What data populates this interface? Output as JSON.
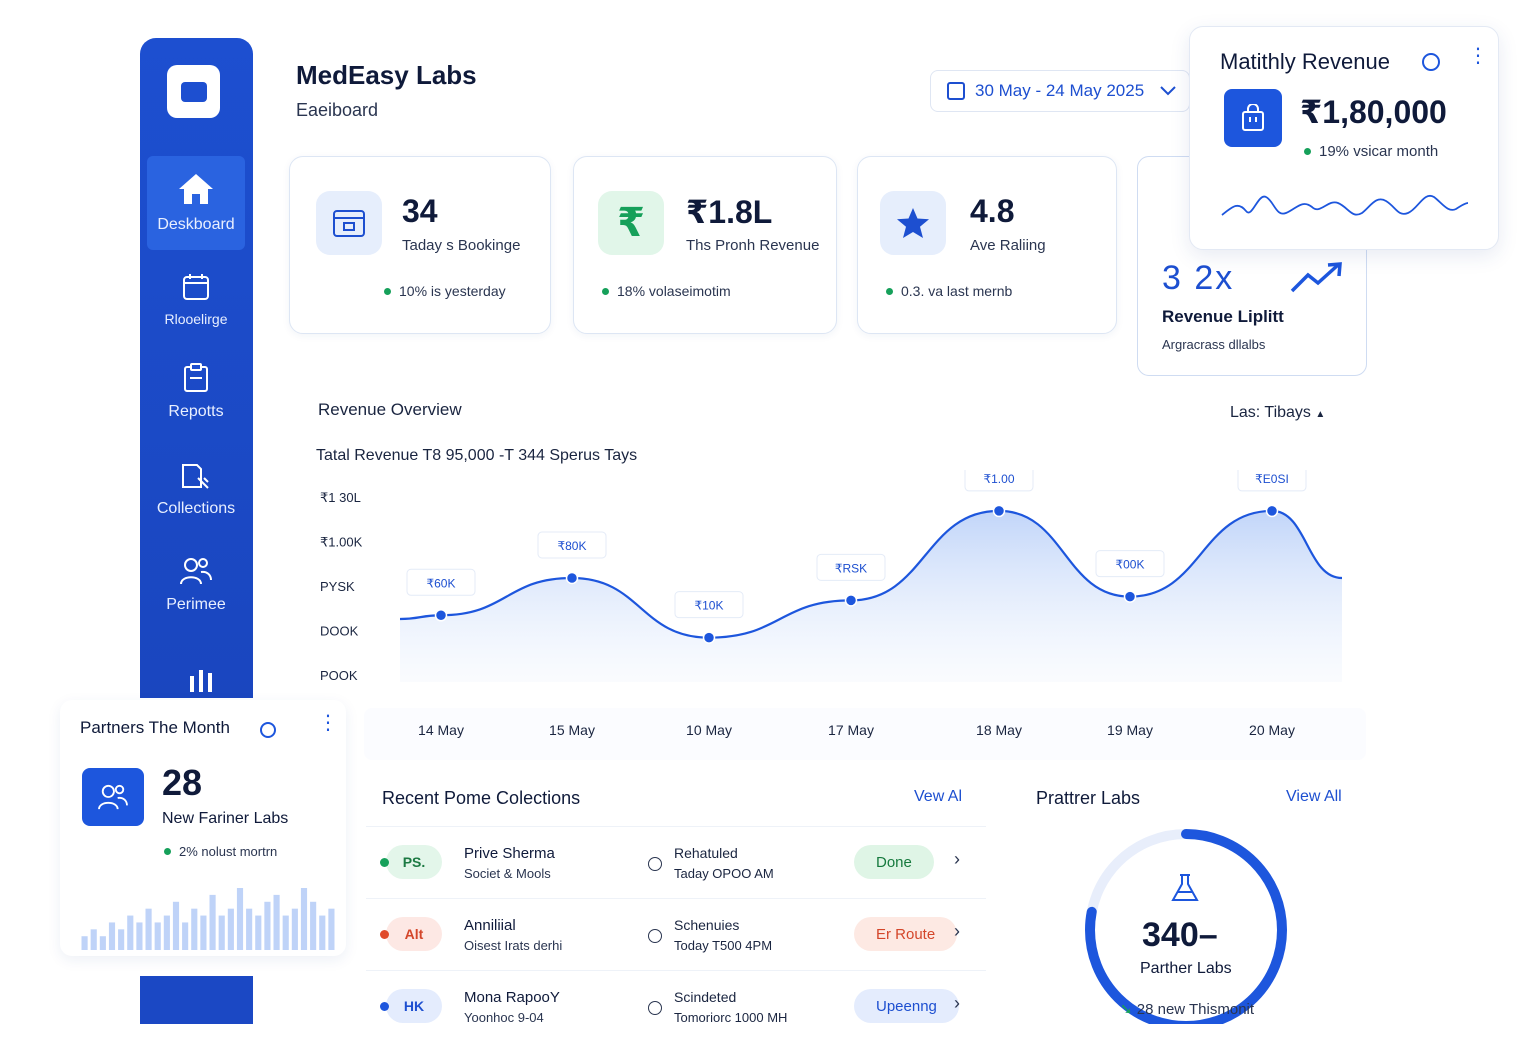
{
  "header": {
    "title": "MedEasy Labs",
    "subtitle": "Eaeiboard"
  },
  "date_range": "30 May - 24 May 2025",
  "sidebar": {
    "items": [
      {
        "label": "Deskboard",
        "icon": "home-icon",
        "active": true
      },
      {
        "label": "Rlooelirge",
        "icon": "calendar-icon"
      },
      {
        "label": "Repotts",
        "icon": "report-icon"
      },
      {
        "label": "Collections",
        "icon": "collections-icon"
      },
      {
        "label": "Perimee",
        "icon": "users-icon"
      }
    ]
  },
  "stats": [
    {
      "value": "34",
      "label": "Taday s Bookinge",
      "note": "10% is yesterday",
      "note_color": "#16a05a"
    },
    {
      "value": "₹1.8L",
      "label": "Ths Pronh Revenue",
      "note": "18% volaseimotim",
      "note_color": "#16a05a"
    },
    {
      "value": "4.8",
      "label": "Ave Raliing",
      "note": "0.3. va last mernb",
      "note_color": "#16a05a"
    }
  ],
  "lift": {
    "value": "3 2x",
    "label": "Revenue Liplitt",
    "sub": "Argracrass dllalbs"
  },
  "monthly": {
    "title": "Matithly Revenue",
    "value": "₹1,80,000",
    "note": "19% vsicar month"
  },
  "chart_data": {
    "type": "area",
    "title": "Revenue Overview",
    "range_label": "Las: Tibays",
    "subtitle": "Tatal Revenue  T8 95,000 -T 344  Sperus Tays",
    "y_tick_labels": [
      "₹1 30L",
      "₹1.00K",
      "PYSK",
      "DOOK",
      "POOK"
    ],
    "x_labels": [
      "14 May",
      "15 May",
      "10 May",
      "17 May",
      "18 May",
      "19 May",
      "20 May"
    ],
    "points": [
      {
        "x": "14 May",
        "value": 5.2,
        "label": "₹60K"
      },
      {
        "x": "15 May",
        "value": 6.2,
        "label": "₹80K"
      },
      {
        "x": "10 May",
        "value": 4.6,
        "label": "₹10K"
      },
      {
        "x": "17 May",
        "value": 5.6,
        "label": "₹RSK"
      },
      {
        "x": "18 May",
        "value": 8.0,
        "label": "₹1.00"
      },
      {
        "x": "19 May",
        "value": 5.7,
        "label": "₹00K"
      },
      {
        "x": "20 May",
        "value": 8.0,
        "label": "₹E0SI"
      }
    ],
    "accent": "#1d56dd"
  },
  "partners": {
    "title": "Partners The Month",
    "value": "28",
    "label": "New Fariner Labs",
    "note": "2% nolust mortrn",
    "bars": [
      2,
      3,
      2,
      4,
      3,
      5,
      4,
      6,
      4,
      5,
      7,
      4,
      6,
      5,
      8,
      5,
      6,
      9,
      6,
      5,
      7,
      8,
      5,
      6,
      9,
      7,
      5,
      6
    ]
  },
  "collections": {
    "title": "Recent Pome Colections",
    "view_all": "Vew Al",
    "rows": [
      {
        "initials": "PS.",
        "avatar_bg": "#e3f6ea",
        "avatar_fg": "#1c7a43",
        "dot": "#16a05a",
        "name": "Prive Sherma",
        "sub": "Societ & Mools",
        "time_label": "Rehatuled",
        "time": "Taday OPOO AM",
        "status": "Done",
        "status_bg": "#dff5e6",
        "status_fg": "#167a3e"
      },
      {
        "initials": "Alt",
        "avatar_bg": "#fde8e4",
        "avatar_fg": "#d4462a",
        "dot": "#e04a2a",
        "name": "Anniliial",
        "sub": "Oisest Irats derhi",
        "time_label": "Schenuies",
        "time": "Today T500 4PM",
        "status": "Er Route",
        "status_bg": "#fde9e3",
        "status_fg": "#d4462a"
      },
      {
        "initials": "HK",
        "avatar_bg": "#e4ecfd",
        "avatar_fg": "#1d4fd0",
        "dot": "#1d56dd",
        "name": "Mona RapooY",
        "sub": "Yoonhoc 9-04",
        "time_label": "Scindeted",
        "time": "Tomoriorc 1000 MH",
        "status": "Upeenng",
        "status_bg": "#e4ecfd",
        "status_fg": "#1d4fd0"
      }
    ]
  },
  "partner_labs": {
    "title": "Prattrer Labs",
    "view_all": "View All",
    "value": "340–",
    "label": "Parther Labs",
    "note": "28 new Thismonit",
    "progress": 0.78
  }
}
